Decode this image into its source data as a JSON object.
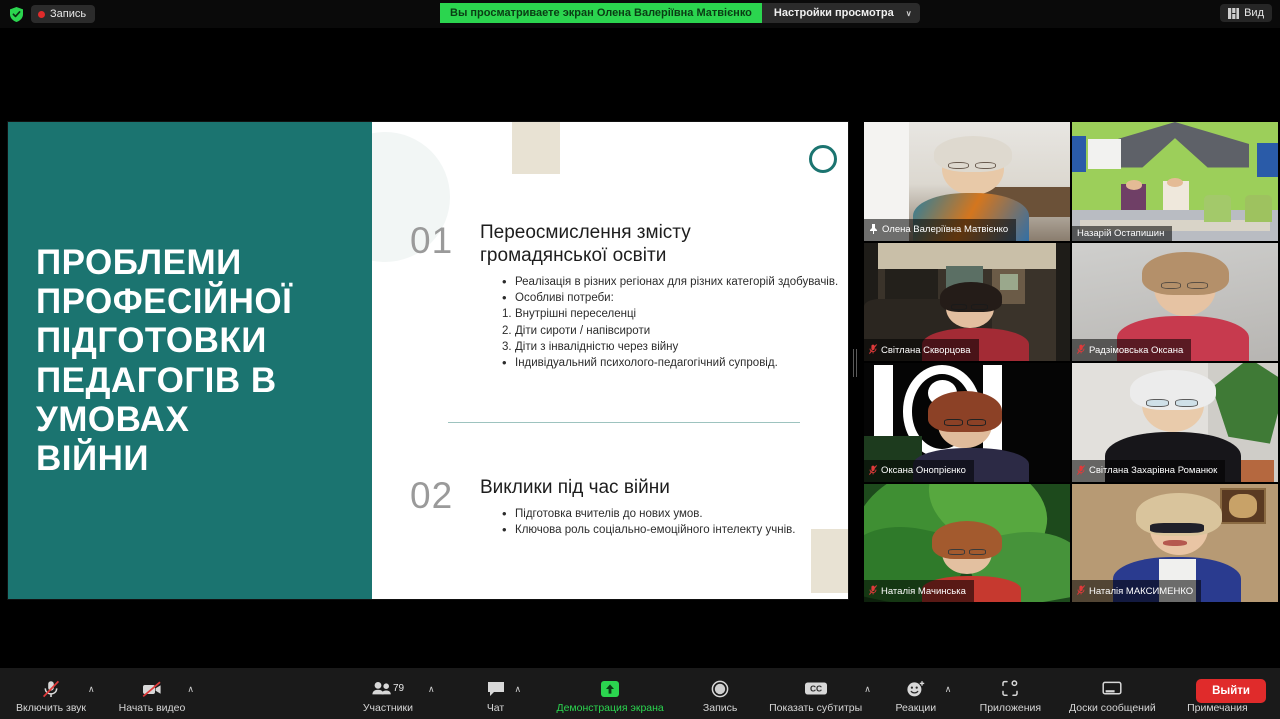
{
  "topbar": {
    "shield_icon": "shield-check-icon",
    "recording_label": "Запись",
    "share_banner": "Вы просматриваете экран Олена Валеріївна Матвієнко",
    "view_settings_label": "Настройки просмотра",
    "view_settings_caret": "∨",
    "view_button_label": "Вид",
    "view_button_icon": "grid-view-icon",
    "accent_green": "#2bd54f",
    "record_red": "#e02b2b"
  },
  "slide": {
    "title": "ПРОБЛЕМИ\nПРОФЕСІЙНОЇ\nПІДГОТОВКИ\nПЕДАГОГІВ В\nУМОВАХ\nВІЙНИ",
    "panel_color": "#1b7470",
    "accent_beige": "#e8e2d3",
    "sections": [
      {
        "number": "01",
        "heading": "Переосмислення змісту\nгромадянської освіти",
        "items": [
          {
            "type": "bullet",
            "text": "Реалізація в різних регіонах для різних категорій здобувачів."
          },
          {
            "type": "bullet",
            "text": "Особливі потреби:"
          },
          {
            "type": "number",
            "marker": "1.",
            "text": "Внутрішні переселенці"
          },
          {
            "type": "number",
            "marker": "2.",
            "text": "Діти сироти / напівсироти"
          },
          {
            "type": "number",
            "marker": "3.",
            "text": "Діти з інвалідністю через війну"
          },
          {
            "type": "bullet",
            "text": "Індивідуальний психолого-педагогічний супровід."
          }
        ]
      },
      {
        "number": "02",
        "heading": "Виклики під час війни",
        "items": [
          {
            "type": "bullet",
            "text": "Підготовка вчителів до нових умов."
          },
          {
            "type": "bullet",
            "text": "Ключова роль соціально-емоційного інтелекту учнів."
          }
        ]
      }
    ]
  },
  "participants": [
    {
      "name": "Олена Валеріївна Матвієнко",
      "status_icon": "pin-icon",
      "active_speaker": true
    },
    {
      "name": "Назарій Остапишин",
      "status_icon": "none",
      "active_speaker": false
    },
    {
      "name": "Світлана Скворцова",
      "status_icon": "mic-muted-icon",
      "active_speaker": false
    },
    {
      "name": "Радзімовська Оксана",
      "status_icon": "mic-muted-icon",
      "active_speaker": false
    },
    {
      "name": "Оксана Онопрієнко",
      "status_icon": "mic-muted-icon",
      "active_speaker": false
    },
    {
      "name": "Світлана Захарівна Романюк",
      "status_icon": "mic-muted-icon",
      "active_speaker": false
    },
    {
      "name": "Наталія Мачинська",
      "status_icon": "mic-muted-icon",
      "active_speaker": false
    },
    {
      "name": "Наталія МАКСИМЕНКО",
      "status_icon": "mic-muted-icon",
      "active_speaker": false
    }
  ],
  "toolbar": {
    "audio_label": "Включить звук",
    "audio_icon": "microphone-muted-icon",
    "video_label": "Начать видео",
    "video_icon": "camera-off-icon",
    "participants_label": "Участники",
    "participants_icon": "people-icon",
    "participants_count": "79",
    "chat_label": "Чат",
    "chat_icon": "chat-bubble-icon",
    "share_label": "Демонстрация экрана",
    "share_icon": "share-screen-icon",
    "record_label": "Запись",
    "record_icon": "record-circle-icon",
    "captions_label": "Показать субтитры",
    "captions_icon": "cc-icon",
    "reactions_label": "Реакции",
    "reactions_icon": "smiley-plus-icon",
    "apps_label": "Приложения",
    "apps_icon": "apps-icon",
    "whiteboards_label": "Доски сообщений",
    "whiteboards_icon": "whiteboard-icon",
    "notes_label": "Примечания",
    "notes_icon": "notes-icon",
    "leave_label": "Выйти",
    "caret": "∧"
  }
}
